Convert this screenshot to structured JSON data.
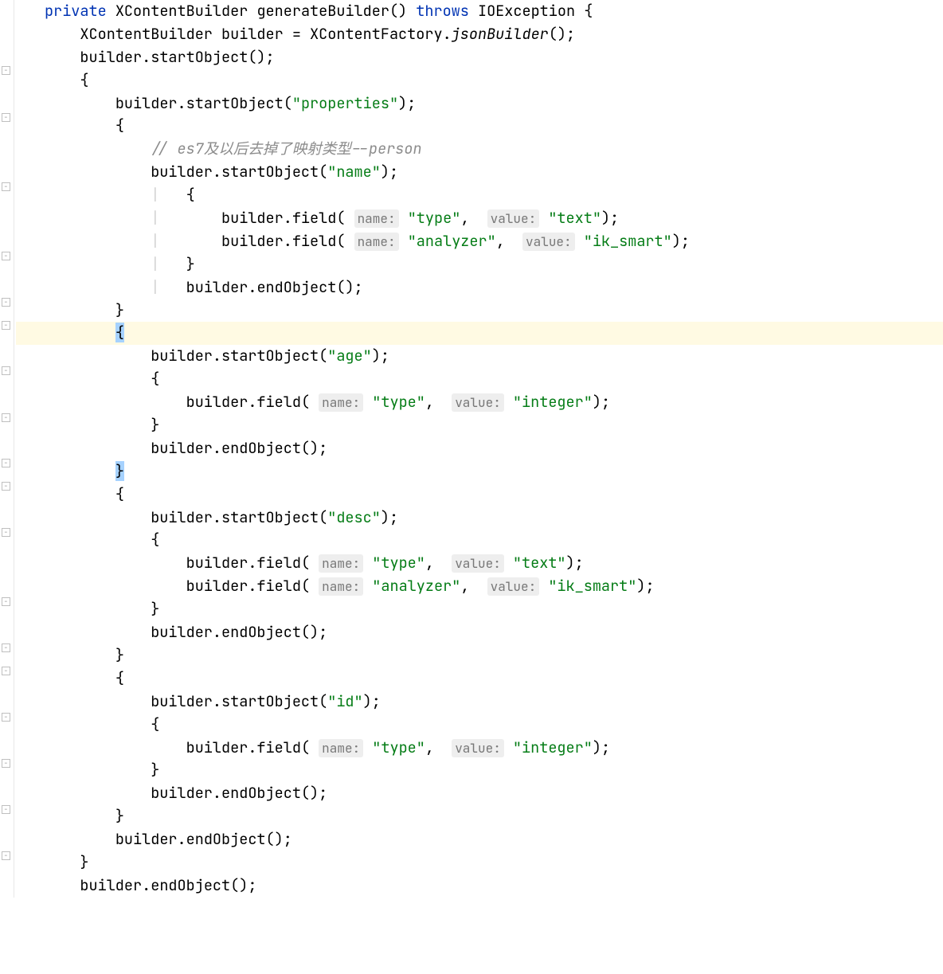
{
  "code": {
    "kw_private": "private",
    "kw_throws": "throws",
    "type_XContentBuilder": "XContentBuilder",
    "type_XContentFactory": "XContentFactory",
    "type_IOException": "IOException",
    "method_generateBuilder": "generateBuilder",
    "method_jsonBuilder": "jsonBuilder",
    "var_builder": "builder",
    "method_startObject": "startObject",
    "method_endObject": "endObject",
    "method_field": "field",
    "str_properties": "\"properties\"",
    "str_name": "\"name\"",
    "str_type": "\"type\"",
    "str_text": "\"text\"",
    "str_analyzer": "\"analyzer\"",
    "str_ik_smart": "\"ik_smart\"",
    "str_age": "\"age\"",
    "str_integer": "\"integer\"",
    "str_desc": "\"desc\"",
    "str_id": "\"id\"",
    "hint_name": "name:",
    "hint_value": "value:",
    "comment_es7": "// es7及以后去掉了映射类型--person",
    "punct": {
      "open_paren": "(",
      "close_paren": ")",
      "open_brace": "{",
      "close_brace": "}",
      "semicolon": ";",
      "comma": ",",
      "dot": ".",
      "equals": " = ",
      "empty_call": "()"
    }
  }
}
